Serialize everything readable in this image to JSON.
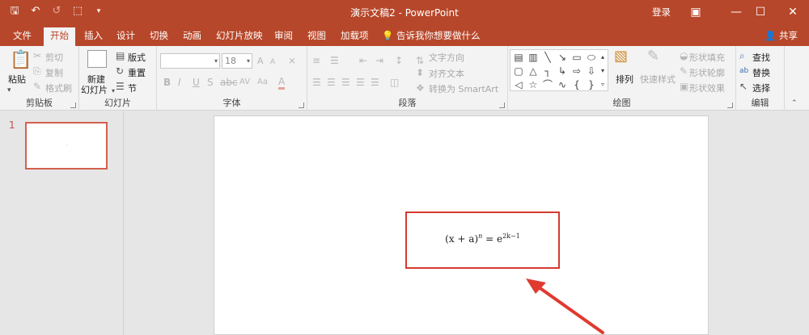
{
  "window": {
    "title": "演示文稿2 - PowerPoint",
    "login": "登录",
    "accent_color": "#b7472a"
  },
  "quick_access": {
    "icons": [
      "save-icon",
      "undo-icon",
      "redo-icon",
      "slideshow-icon",
      "customize-icon"
    ]
  },
  "tabs": [
    {
      "label": "文件"
    },
    {
      "label": "开始",
      "active": true
    },
    {
      "label": "插入"
    },
    {
      "label": "设计"
    },
    {
      "label": "切换"
    },
    {
      "label": "动画"
    },
    {
      "label": "幻灯片放映"
    },
    {
      "label": "审阅"
    },
    {
      "label": "视图"
    },
    {
      "label": "加载项"
    }
  ],
  "tellme": "告诉我你想要做什么",
  "share": "共享",
  "ribbon": {
    "clipboard": {
      "label": "剪贴板",
      "paste": "粘贴",
      "cut": "剪切",
      "copy": "复制",
      "format_painter": "格式刷"
    },
    "slides": {
      "label": "幻灯片",
      "new_slide": "新建",
      "new_slide_2": "幻灯片",
      "layout": "版式",
      "reset": "重置",
      "section": "节"
    },
    "font": {
      "label": "字体",
      "font_name": "",
      "font_size": "18",
      "bold": "B",
      "italic": "I",
      "underline": "U",
      "strike": "S",
      "spacing": "AV",
      "case": "Aa",
      "color": "A",
      "grow": "A",
      "shrink": "A"
    },
    "paragraph": {
      "label": "段落",
      "text_direction": "文字方向",
      "align_text": "对齐文本",
      "smartart": "转换为 SmartArt"
    },
    "drawing": {
      "label": "绘图",
      "arrange": "排列",
      "quick_styles": "快速样式",
      "shape_fill": "形状填充",
      "shape_outline": "形状轮廓",
      "shape_effects": "形状效果"
    },
    "editing": {
      "label": "编辑",
      "find": "查找",
      "replace": "替换",
      "select": "选择"
    }
  },
  "slide_panel": {
    "slide_number": "1"
  },
  "slide": {
    "formula_base": "(x + a)",
    "formula_exp": "n",
    "formula_eq": " = e",
    "formula_rhs_exp": "2k−1"
  }
}
